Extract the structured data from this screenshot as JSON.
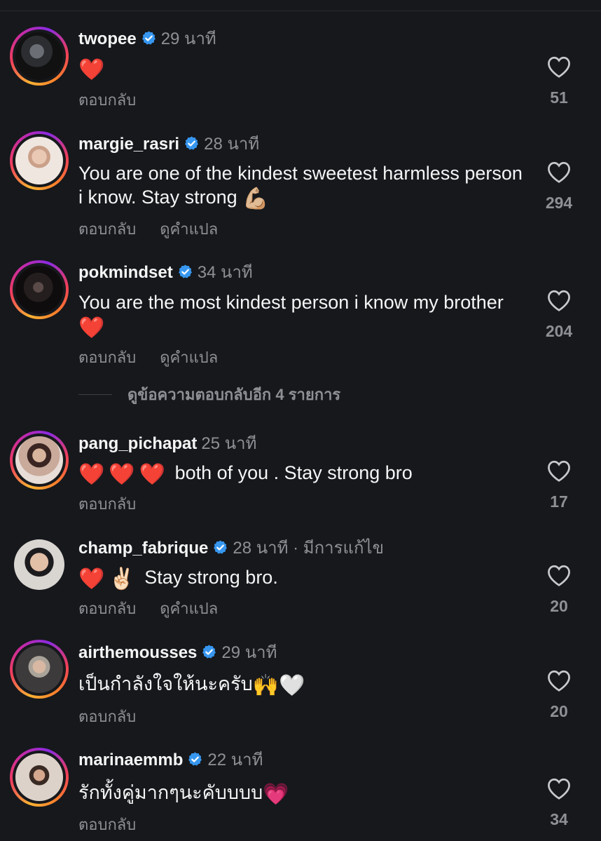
{
  "ui": {
    "reply_label": "ตอบกลับ",
    "translate_label": "ดูคำแปล",
    "more_replies_label": "ดูข้อความตอบกลับอีก 4 รายการ"
  },
  "colors": {
    "background": "#16181c",
    "verified_badge": "#3797f0",
    "secondary_text": "#8e9095",
    "heart_emoji": "#e3202f"
  },
  "comments": [
    {
      "username": "twopee",
      "verified": true,
      "time": "29 นาที",
      "text": "",
      "emojis": "❤️",
      "likes": "51",
      "story_ring": true
    },
    {
      "username": "margie_rasri",
      "verified": true,
      "time": "28 นาที",
      "text": "You are one of the kindest sweetest harmless person i know. Stay strong",
      "emojis": "💪🏼",
      "likes": "294",
      "story_ring": true
    },
    {
      "username": "pokmindset",
      "verified": true,
      "time": "34 นาที",
      "text": "You are the most kindest person i know my brother",
      "emojis": "❤️",
      "likes": "204",
      "story_ring": true
    },
    {
      "username": "pang_pichapat",
      "verified": false,
      "time": "25 นาที",
      "text": "both of you . Stay strong bro",
      "emojis": "❤️❤️❤️",
      "likes": "17",
      "story_ring": true
    },
    {
      "username": "champ_fabrique",
      "verified": true,
      "time": "28 นาที · มีการแก้ไข",
      "text": "Stay strong bro.",
      "emojis": "❤️✌🏻",
      "likes": "20",
      "story_ring": false
    },
    {
      "username": "airthemousses",
      "verified": true,
      "time": "29 นาที",
      "text": "เป็นกำลังใจให้นะครับ",
      "emojis": "🙌🤍",
      "likes": "20",
      "story_ring": true
    },
    {
      "username": "marinaemmb",
      "verified": true,
      "time": "22 นาที",
      "text": "รักทั้งคู่มากๆนะคับบบบ",
      "emojis": "💗",
      "likes": "34",
      "story_ring": true
    }
  ]
}
